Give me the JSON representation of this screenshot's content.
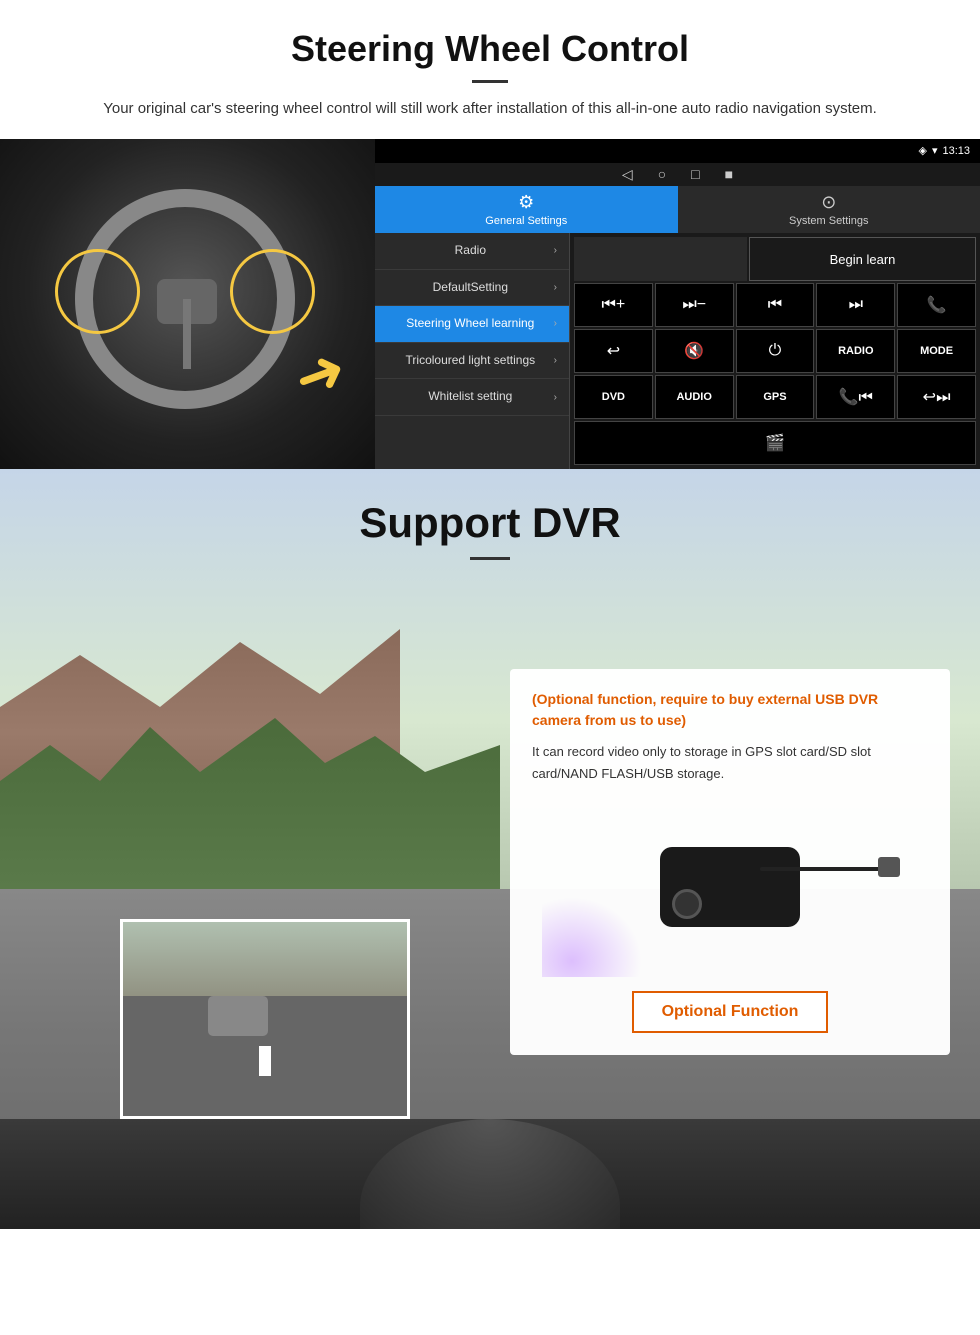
{
  "section1": {
    "title": "Steering Wheel Control",
    "subtitle": "Your original car's steering wheel control will still work after installation of this all-in-one auto radio navigation system.",
    "tabs": {
      "general": "General Settings",
      "system": "System Settings"
    },
    "menu": {
      "items": [
        {
          "label": "Radio",
          "active": false
        },
        {
          "label": "DefaultSetting",
          "active": false
        },
        {
          "label": "Steering Wheel learning",
          "active": true
        },
        {
          "label": "Tricoloured light settings",
          "active": false
        },
        {
          "label": "Whitelist setting",
          "active": false
        }
      ]
    },
    "begin_learn": "Begin learn",
    "controls": {
      "row1": [
        "⏮+",
        "⏭-",
        "⏮",
        "⏭",
        "📞"
      ],
      "row1_text": [
        "◀|+",
        "◀|-",
        "|◀◀",
        "▶▶|",
        "☎"
      ],
      "row2_text": [
        "↩",
        "🔇",
        "⏻",
        "RADIO",
        "MODE"
      ],
      "row3_text": [
        "DVD",
        "AUDIO",
        "GPS",
        "📞|◀◀",
        "↩▶▶|"
      ],
      "row4_text": [
        "🎬"
      ]
    },
    "statusbar": {
      "time": "13:13",
      "nav_icons": [
        "◁",
        "○",
        "□",
        "■"
      ]
    }
  },
  "section2": {
    "title": "Support DVR",
    "info_card": {
      "orange_text": "(Optional function, require to buy external USB DVR camera from us to use)",
      "body_text": "It can record video only to storage in GPS slot card/SD slot card/NAND FLASH/USB storage.",
      "button_label": "Optional Function"
    }
  }
}
